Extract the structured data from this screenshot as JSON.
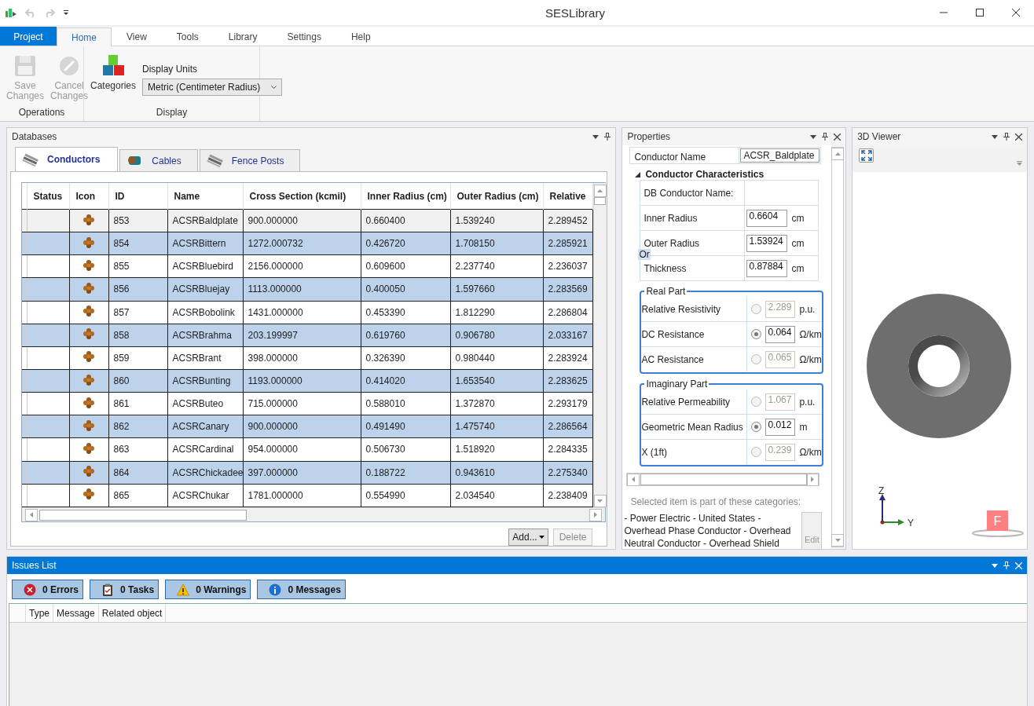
{
  "window": {
    "title": "SESLibrary"
  },
  "ribbon": {
    "tabs": [
      {
        "label": "Project",
        "kind": "backstage",
        "selected": false
      },
      {
        "label": "Home",
        "kind": "tab",
        "selected": true
      },
      {
        "label": "View",
        "kind": "tab",
        "selected": false
      },
      {
        "label": "Tools",
        "kind": "tab",
        "selected": false
      },
      {
        "label": "Library",
        "kind": "tab",
        "selected": false
      },
      {
        "label": "Settings",
        "kind": "tab",
        "selected": false
      },
      {
        "label": "Help",
        "kind": "tab",
        "selected": false
      }
    ],
    "groups": [
      {
        "label": "Operations",
        "buttons": [
          {
            "label": "Save Changes",
            "kind": "save",
            "disabled": true
          },
          {
            "label": "Cancel Changes",
            "kind": "cancel",
            "disabled": true
          }
        ]
      },
      {
        "label": "Display",
        "buttons": [
          {
            "label": "Categories",
            "kind": "categories",
            "disabled": false
          }
        ],
        "dropdown": {
          "label": "Display Units",
          "value": "Metric (Centimeter Radius)"
        }
      }
    ]
  },
  "databases": {
    "title": "Databases",
    "tabs": [
      {
        "label": "Conductors",
        "kind": "conductor",
        "selected": true
      },
      {
        "label": "Cables",
        "kind": "cable",
        "selected": false
      },
      {
        "label": "Fence Posts",
        "kind": "conductor",
        "selected": false
      }
    ],
    "table": {
      "columns": [
        "Status",
        "Icon",
        "ID",
        "Name",
        "Cross Section (kcmil)",
        "Inner Radius (cm)",
        "Outer Radius (cm)",
        "Relative"
      ],
      "rows": [
        {
          "id": "853",
          "name": "ACSRBaldplate",
          "cross_section": "900.000000",
          "inner_radius": "0.660400",
          "outer_radius": "1.539240",
          "relative": "2.289452",
          "selected": true
        },
        {
          "id": "854",
          "name": "ACSRBittern",
          "cross_section": "1272.000732",
          "inner_radius": "0.426720",
          "outer_radius": "1.708150",
          "relative": "2.285921",
          "selected": false
        },
        {
          "id": "855",
          "name": "ACSRBluebird",
          "cross_section": "2156.000000",
          "inner_radius": "0.609600",
          "outer_radius": "2.237740",
          "relative": "2.236037",
          "selected": false
        },
        {
          "id": "856",
          "name": "ACSRBluejay",
          "cross_section": "1113.000000",
          "inner_radius": "0.400050",
          "outer_radius": "1.597660",
          "relative": "2.283569",
          "selected": false
        },
        {
          "id": "857",
          "name": "ACSRBobolink",
          "cross_section": "1431.000000",
          "inner_radius": "0.453390",
          "outer_radius": "1.812290",
          "relative": "2.286804",
          "selected": false
        },
        {
          "id": "858",
          "name": "ACSRBrahma",
          "cross_section": "203.199997",
          "inner_radius": "0.619760",
          "outer_radius": "0.906780",
          "relative": "2.033167",
          "selected": false
        },
        {
          "id": "859",
          "name": "ACSRBrant",
          "cross_section": "398.000000",
          "inner_radius": "0.326390",
          "outer_radius": "0.980440",
          "relative": "2.283924",
          "selected": false
        },
        {
          "id": "860",
          "name": "ACSRBunting",
          "cross_section": "1193.000000",
          "inner_radius": "0.414020",
          "outer_radius": "1.653540",
          "relative": "2.283625",
          "selected": false
        },
        {
          "id": "861",
          "name": "ACSRButeo",
          "cross_section": "715.000000",
          "inner_radius": "0.588010",
          "outer_radius": "1.372870",
          "relative": "2.293179",
          "selected": false
        },
        {
          "id": "862",
          "name": "ACSRCanary",
          "cross_section": "900.000000",
          "inner_radius": "0.491490",
          "outer_radius": "1.475740",
          "relative": "2.286564",
          "selected": false
        },
        {
          "id": "863",
          "name": "ACSRCardinal",
          "cross_section": "954.000000",
          "inner_radius": "0.506730",
          "outer_radius": "1.518920",
          "relative": "2.284335",
          "selected": false
        },
        {
          "id": "864",
          "name": "ACSRChickadee",
          "cross_section": "397.000000",
          "inner_radius": "0.188722",
          "outer_radius": "0.943610",
          "relative": "2.275340",
          "selected": false
        },
        {
          "id": "865",
          "name": "ACSRChukar",
          "cross_section": "1781.000000",
          "inner_radius": "0.554990",
          "outer_radius": "2.034540",
          "relative": "2.238409",
          "selected": false
        }
      ]
    },
    "buttons": [
      {
        "label": "Add...",
        "kind": "menu",
        "disabled": false
      },
      {
        "label": "Delete",
        "kind": "plain",
        "disabled": true
      }
    ]
  },
  "properties": {
    "title": "Properties",
    "name_field": {
      "label": "Conductor Name",
      "value": "ACSR_Baldplate"
    },
    "section": {
      "title": "Conductor Characteristics",
      "expanded": true
    },
    "rows": [
      {
        "label": "DB Conductor Name:"
      },
      {
        "label": "Inner Radius",
        "value": "0.6604",
        "unit": "cm"
      },
      {
        "label": "Outer Radius",
        "value": "1.53924",
        "unit": "cm"
      },
      {
        "label": "Thickness",
        "value": "0.87884",
        "unit": "cm"
      }
    ],
    "or_note": "Or",
    "groups": [
      {
        "title": "Real Part",
        "rows": [
          {
            "label": "Relative Resistivity",
            "value": "2.289",
            "unit": "p.u.",
            "selected": false
          },
          {
            "label": "DC Resistance",
            "value": "0.064",
            "unit": "Ω/km",
            "selected": true
          },
          {
            "label": "AC Resistance",
            "value": "0.065",
            "unit": "Ω/km",
            "selected": false
          }
        ]
      },
      {
        "title": "Imaginary Part",
        "rows": [
          {
            "label": "Relative Permeability",
            "value": "1.067",
            "unit": "p.u.",
            "selected": false
          },
          {
            "label": "Geometric Mean Radius",
            "value": "0.012",
            "unit": "m",
            "selected": true
          },
          {
            "label": "X (1ft)",
            "value": "0.239",
            "unit": "Ω/km",
            "selected": false
          }
        ]
      }
    ],
    "categories_caption": "Selected item is part of these categories:",
    "categories": " - Power Electric - United States - Overhead Phase Conductor - Overhead Neutral Conductor - Overhead Shield",
    "edit_button": "Edit"
  },
  "viewer": {
    "title": "3D Viewer",
    "axis_z": "Z",
    "axis_y": "Y",
    "cube_face": "F"
  },
  "issues": {
    "title": "Issues List",
    "filters": [
      {
        "label": "0 Errors",
        "kind": "error"
      },
      {
        "label": "0 Tasks",
        "kind": "task"
      },
      {
        "label": "0 Warnings",
        "kind": "warning"
      },
      {
        "label": "0 Messages",
        "kind": "info"
      }
    ],
    "columns": [
      "Type",
      "Message",
      "Related object"
    ]
  }
}
